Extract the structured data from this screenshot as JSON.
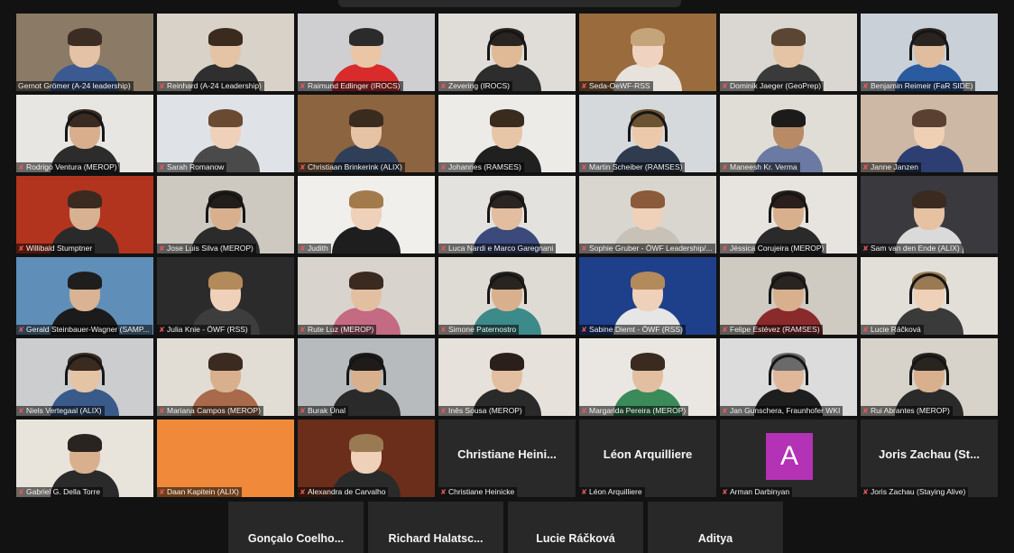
{
  "tiles": [
    {
      "name": "Gernot Grömer (A-24 leadership)",
      "active": true,
      "bg": "#8b7b66",
      "skin": "#e4c2a6",
      "hair": "#3b2d24",
      "shirt": "#3b5a92",
      "headset": false
    },
    {
      "name": "Reinhard (A-24 Leadership)",
      "bg": "#d8d2c8",
      "skin": "#e5c3a5",
      "hair": "#3b2b1e",
      "shirt": "#2f2f2f",
      "headset": false
    },
    {
      "name": "Raimund Edlinger (IROCS)",
      "bg": "#cfcfd2",
      "skin": "#eac5a6",
      "hair": "#2b2b2b",
      "shirt": "#d92b2b",
      "headset": false
    },
    {
      "name": "Zevering (IROCS)",
      "bg": "#e0ddd8",
      "skin": "#e0b996",
      "hair": "#2a2420",
      "shirt": "#2d2d2d",
      "headset": true
    },
    {
      "name": "Seda-OeWF-RSS",
      "bg": "#9a6b3d",
      "skin": "#efd3c0",
      "hair": "#c4a47a",
      "shirt": "#e8e2dc",
      "headset": false
    },
    {
      "name": "Dominik Jaeger (GeoPrep)",
      "bg": "#dad7d2",
      "skin": "#e5c3a5",
      "hair": "#5a4632",
      "shirt": "#3a3a3a",
      "headset": false
    },
    {
      "name": "Benjamin Reimeir (FaR SIDE)",
      "bg": "#c9d0d8",
      "skin": "#dfbd9e",
      "hair": "#2a2420",
      "shirt": "#2a5aa0",
      "headset": true
    },
    {
      "name": "Rodrigo Ventura (MEROP)",
      "bg": "#e8e6e2",
      "skin": "#d8ae8c",
      "hair": "#3a2b22",
      "shirt": "#2c2c2c",
      "headset": true
    },
    {
      "name": "Sarah Romanow",
      "bg": "#dfe2e6",
      "skin": "#efd0b9",
      "hair": "#6b4a32",
      "shirt": "#4a4a4a",
      "headset": false
    },
    {
      "name": "Christiaan Brinkerink (ALIX)",
      "bg": "#8d6440",
      "skin": "#e6c3a4",
      "hair": "#3a2b1f",
      "shirt": "#2f3f58",
      "headset": false
    },
    {
      "name": "Johannes (RAMSES)",
      "bg": "#ecebe8",
      "skin": "#e7c6a8",
      "hair": "#3a2b1f",
      "shirt": "#202020",
      "headset": false
    },
    {
      "name": "Martin Scheiber (RAMSES)",
      "bg": "#d6d9dc",
      "skin": "#edc9ab",
      "hair": "#6b5332",
      "shirt": "#2f3b4f",
      "headset": true
    },
    {
      "name": "Maneesh Kr. Verma",
      "bg": "#e0ddd6",
      "skin": "#b88a66",
      "hair": "#1d1b1a",
      "shirt": "#6a7aa2",
      "headset": false
    },
    {
      "name": "Janne Janzen",
      "bg": "#cdb8a6",
      "skin": "#efd0b5",
      "hair": "#5a4030",
      "shirt": "#2d3f72",
      "headset": false
    },
    {
      "name": "Willibald Stumptner",
      "bg": "#b2341e",
      "skin": "#d7b192",
      "hair": "#3a2a20",
      "shirt": "#2a2a2a",
      "headset": false
    },
    {
      "name": "Jose Luis Silva (MEROP)",
      "bg": "#cec9c0",
      "skin": "#d9b08d",
      "hair": "#231d1a",
      "shirt": "#2b2b2b",
      "headset": true
    },
    {
      "name": "Judith",
      "bg": "#f0efec",
      "skin": "#efd0b8",
      "hair": "#a37a4c",
      "shirt": "#1e1e1e",
      "headset": false
    },
    {
      "name": "Luca Nardi e Marco Garegnani",
      "bg": "#e3e2df",
      "skin": "#e2bd9f",
      "hair": "#2b2420",
      "shirt": "#3b4a7a",
      "headset": true
    },
    {
      "name": "Sophie Gruber - ÖWF Leadership/...",
      "bg": "#d9d6d0",
      "skin": "#efd0b8",
      "hair": "#8a5a3a",
      "shirt": "#c8c1b8",
      "headset": false
    },
    {
      "name": "Jéssica Corujeira (MEROP)",
      "bg": "#e7e4e0",
      "skin": "#d9b08d",
      "hair": "#2a1f1a",
      "shirt": "#2a2a2a",
      "headset": true
    },
    {
      "name": "Sam van den Ende (ALIX)",
      "bg": "#3a3a3e",
      "skin": "#e6c2a3",
      "hair": "#3a2a20",
      "shirt": "#dadada",
      "headset": false
    },
    {
      "name": "Gerald Steinbauer-Wagner (SAMP...",
      "bg": "#5f8fb8",
      "skin": "#d9b393",
      "hair": "#1e1e1e",
      "shirt": "#1b1b1b",
      "headset": false
    },
    {
      "name": "Julia Knie - ÖWF (RSS)",
      "bg": "#2b2b2b",
      "skin": "#efd0b8",
      "hair": "#b38a5a",
      "shirt": "#3d3d3d",
      "headset": false
    },
    {
      "name": "Rute Luz (MEROP)",
      "bg": "#d8d4cd",
      "skin": "#e3bfa2",
      "hair": "#3a2a20",
      "shirt": "#c46a82",
      "headset": false
    },
    {
      "name": "Simone Paternostro",
      "bg": "#dedbd4",
      "skin": "#d9b08d",
      "hair": "#2a2420",
      "shirt": "#3c8a8a",
      "headset": true
    },
    {
      "name": "Sabine Diemt - ÖWF (RSS)",
      "bg": "#1e3f8a",
      "skin": "#efd0b8",
      "hair": "#b38a5a",
      "shirt": "#e6e6e6",
      "headset": false
    },
    {
      "name": "Felipe Estévez (RAMSES)",
      "bg": "#cfcac2",
      "skin": "#d9b08d",
      "hair": "#2a2420",
      "shirt": "#8a2a2a",
      "headset": true
    },
    {
      "name": "Lucie Ráčková",
      "bg": "#e2dfd8",
      "skin": "#efd0b8",
      "hair": "#9a7a52",
      "shirt": "#3a3a3a",
      "headset": true
    },
    {
      "name": "Niels Vertegaal (ALIX)",
      "bg": "#cbcdcf",
      "skin": "#e5c3a5",
      "hair": "#3a2a20",
      "shirt": "#3a5a8a",
      "headset": true
    },
    {
      "name": "Mariana Campos (MEROP)",
      "bg": "#e2ddd4",
      "skin": "#d9b08d",
      "hair": "#3a2a20",
      "shirt": "#a86a4a",
      "headset": false
    },
    {
      "name": "Burak Ünal",
      "bg": "#b8bbbd",
      "skin": "#d9b08d",
      "hair": "#1e1b1a",
      "shirt": "#2a2a2a",
      "headset": true
    },
    {
      "name": "Inês Sousa (MEROP)",
      "bg": "#e6e2db",
      "skin": "#e3bfa2",
      "hair": "#2a1f1a",
      "shirt": "#2a2a2a",
      "headset": false
    },
    {
      "name": "Margarida Pereira (MEROP)",
      "bg": "#eae7e2",
      "skin": "#e3bfa2",
      "hair": "#3a2a20",
      "shirt": "#3a8a5a",
      "headset": false
    },
    {
      "name": "Jan Gunschera, Fraunhofer WKI",
      "bg": "#dcdcdc",
      "skin": "#e1b79a",
      "hair": "#6a6a6a",
      "shirt": "#1e1e1e",
      "headset": true
    },
    {
      "name": "Rui Abrantes (MEROP)",
      "bg": "#d8d3ca",
      "skin": "#d9b08d",
      "hair": "#2a2420",
      "shirt": "#2a2a2a",
      "headset": true
    },
    {
      "name": "Gabriel G. Della Torre",
      "bg": "#e8e4dc",
      "skin": "#d9b08d",
      "hair": "#2a2420",
      "shirt": "#2a2a2a",
      "headset": false
    },
    {
      "name": "Daan Kapitein (ALIX)",
      "bg": "#f08a3a",
      "plain": true
    },
    {
      "name": "Alexandra de Carvalho",
      "bg": "#6a2e1a",
      "skin": "#efd0b8",
      "hair": "#9a7a52",
      "shirt": "#2a2a2a",
      "headset": false
    },
    {
      "name": "Christiane Heinicke",
      "display": "Christiane Heini...",
      "nameonly": true
    },
    {
      "name": "Léon Arquilliere",
      "display": "Léon Arquilliere",
      "nameonly": true
    },
    {
      "name": "Arman Darbinyan",
      "avatar": "A",
      "avatar_color": "#b332b5"
    },
    {
      "name": "Joris Zachau (Staying Alive)",
      "display": "Joris Zachau (St...",
      "nameonly": true
    }
  ],
  "bottom_row": [
    {
      "display": "Gonçalo Coelho..."
    },
    {
      "display": "Richard Halatsc..."
    },
    {
      "display": "Lucie Ráčková"
    },
    {
      "display": "Aditya"
    }
  ]
}
